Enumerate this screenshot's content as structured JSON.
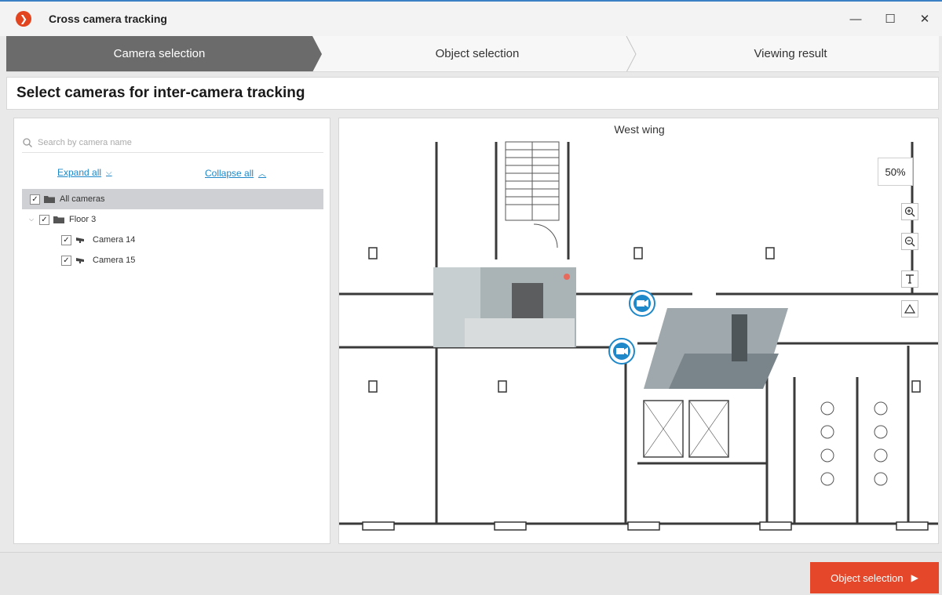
{
  "window": {
    "title": "Cross camera tracking",
    "controls": {
      "minimize": "—",
      "maximize": "☐",
      "close": "✕"
    }
  },
  "steps": [
    {
      "label": "Camera selection",
      "active": true
    },
    {
      "label": "Object selection",
      "active": false
    },
    {
      "label": "Viewing result",
      "active": false
    }
  ],
  "heading": "Select cameras for inter-camera tracking",
  "left_panel": {
    "search_placeholder": "Search by camera name",
    "expand_all": "Expand all",
    "collapse_all": "Collapse all",
    "tree": [
      {
        "label": "All cameras",
        "type": "folder",
        "checked": true,
        "selected": true
      },
      {
        "label": "Floor 3",
        "type": "folder",
        "checked": true,
        "expanded": true
      },
      {
        "label": "Camera 14",
        "type": "camera",
        "checked": true
      },
      {
        "label": "Camera 15",
        "type": "camera",
        "checked": true
      }
    ]
  },
  "map": {
    "title": "West wing",
    "zoom": "50%",
    "tools": [
      "zoom-in-icon",
      "zoom-out-icon",
      "text-tool-icon",
      "shape-tool-icon"
    ]
  },
  "footer": {
    "next_button": "Object selection"
  },
  "colors": {
    "accent": "#e4472a",
    "active_step": "#6b6b6b",
    "link": "#1e88c8",
    "camera_marker": "#1e88c8"
  }
}
